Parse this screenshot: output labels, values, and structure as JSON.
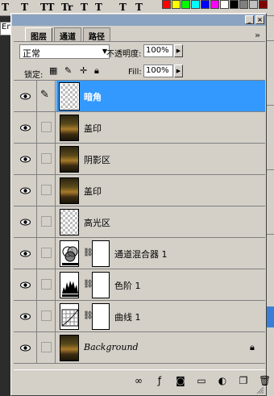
{
  "topbar": {
    "glyphs": [
      "T",
      "T",
      "TT",
      "Tr",
      "T",
      "T",
      "T",
      "T"
    ],
    "swatches": [
      "#ff0000",
      "#ffff00",
      "#00ff00",
      "#00ffff",
      "#0000ff",
      "#ff00ff",
      "#ffffff",
      "#000000",
      "#808080",
      "#c0c0c0",
      "#800000"
    ],
    "english_input": "English"
  },
  "panel": {
    "tabs": [
      {
        "label": "图层",
        "active": true
      },
      {
        "label": "通道",
        "active": false
      },
      {
        "label": "路径",
        "active": false
      }
    ],
    "menu_button": "»",
    "blend_mode": "正常",
    "opacity_label": "不透明度:",
    "opacity_value": "100%",
    "lock_label": "锁定:",
    "fill_label": "Fill:",
    "fill_value": "100%"
  },
  "layers": [
    {
      "name": "暗角",
      "thumb": "checker",
      "selected": true,
      "mask": false,
      "brush": true
    },
    {
      "name": "盖印",
      "thumb": "photo",
      "selected": false,
      "mask": false
    },
    {
      "name": "阴影区",
      "thumb": "photo",
      "selected": false,
      "mask": false
    },
    {
      "name": "盖印",
      "thumb": "photo",
      "selected": false,
      "mask": false
    },
    {
      "name": "高光区",
      "thumb": "checker",
      "selected": false,
      "mask": false
    },
    {
      "name": "通道混合器 1",
      "thumb": "adj-mixer",
      "selected": false,
      "mask": true
    },
    {
      "name": "色阶 1",
      "thumb": "adj-levels",
      "selected": false,
      "mask": true
    },
    {
      "name": "曲线 1",
      "thumb": "adj-curves",
      "selected": false,
      "mask": true
    },
    {
      "name": "Background",
      "thumb": "photo",
      "selected": false,
      "mask": false,
      "locked": true
    }
  ],
  "bottom_icons": [
    "link-layers-icon",
    "layer-style-icon",
    "add-mask-icon",
    "new-group-icon",
    "adjustment-layer-icon",
    "new-layer-icon",
    "trash-icon"
  ],
  "colors": {
    "selection": "#3399ff",
    "panel_bg": "#d4d0c8",
    "titlebar": "#8aa3c2"
  }
}
